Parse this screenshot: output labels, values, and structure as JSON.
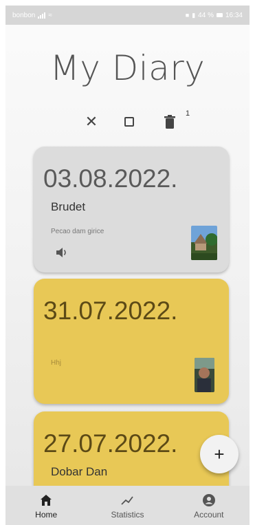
{
  "status_bar": {
    "carrier": "bonbon",
    "battery": "44 %",
    "time": "16:34"
  },
  "app": {
    "title": "My Diary"
  },
  "toolbar": {
    "delete_count": "1",
    "icons": [
      "close-icon",
      "checkbox-icon",
      "trash-icon"
    ]
  },
  "entries": [
    {
      "date": "03.08.2022.",
      "title": "Brudet",
      "note": "Pecao dam girice",
      "has_audio": true,
      "color": "#dcdcdc"
    },
    {
      "date": "31.07.2022.",
      "title": "",
      "note": "Hhj",
      "has_audio": false,
      "color": "#e8c856"
    },
    {
      "date": "27.07.2022.",
      "title": "Dobar Dan",
      "note": "",
      "has_audio": false,
      "color": "#e8c856"
    }
  ],
  "fab": {
    "label": "+"
  },
  "nav": {
    "items": [
      {
        "label": "Home",
        "icon": "home-icon",
        "active": true
      },
      {
        "label": "Statistics",
        "icon": "trend-icon",
        "active": false
      },
      {
        "label": "Account",
        "icon": "account-icon",
        "active": false
      }
    ]
  }
}
